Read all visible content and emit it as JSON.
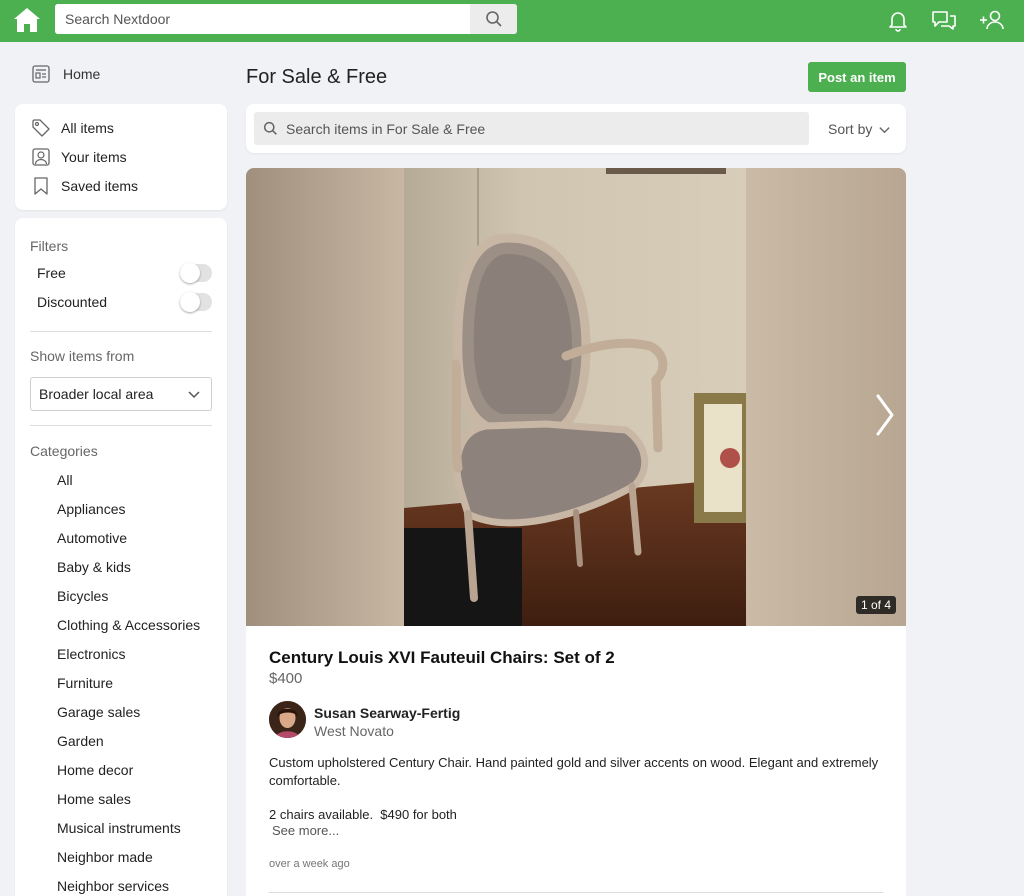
{
  "topbar": {
    "search_placeholder": "Search Nextdoor",
    "icons": [
      "house-logo-icon",
      "search-icon",
      "bell-icon",
      "chat-icon",
      "add-user-icon"
    ]
  },
  "sidebar": {
    "home_label": "Home",
    "items_nav": [
      {
        "label": "All items",
        "icon": "tag-icon"
      },
      {
        "label": "Your items",
        "icon": "user-icon"
      },
      {
        "label": "Saved items",
        "icon": "bookmark-icon"
      }
    ],
    "filters_title": "Filters",
    "filters": [
      {
        "label": "Free",
        "on": false
      },
      {
        "label": "Discounted",
        "on": false
      }
    ],
    "show_from_title": "Show items from",
    "show_from_value": "Broader local area",
    "categories_title": "Categories",
    "categories": [
      "All",
      "Appliances",
      "Automotive",
      "Baby & kids",
      "Bicycles",
      "Clothing & Accessories",
      "Electronics",
      "Furniture",
      "Garage sales",
      "Garden",
      "Home decor",
      "Home sales",
      "Musical instruments",
      "Neighbor made",
      "Neighbor services"
    ]
  },
  "main": {
    "page_title": "For Sale & Free",
    "post_button": "Post an item",
    "search_placeholder": "Search items in For Sale & Free",
    "sort_label": "Sort by",
    "listing": {
      "photo_counter": "1 of 4",
      "title": "Century Louis XVI Fauteuil Chairs: Set of 2",
      "price": "$400",
      "seller_name": "Susan Searway-Fertig",
      "seller_location": "West Novato",
      "description": "Custom upholstered Century Chair. Hand painted gold and silver accents on wood. Elegant and extremely comfortable.",
      "description_2": "2 chairs available.  $490 for both",
      "see_more": "See more...",
      "posted": "over a week ago"
    }
  },
  "colors": {
    "brand_green": "#4caf50",
    "background": "#f0f2f5"
  }
}
